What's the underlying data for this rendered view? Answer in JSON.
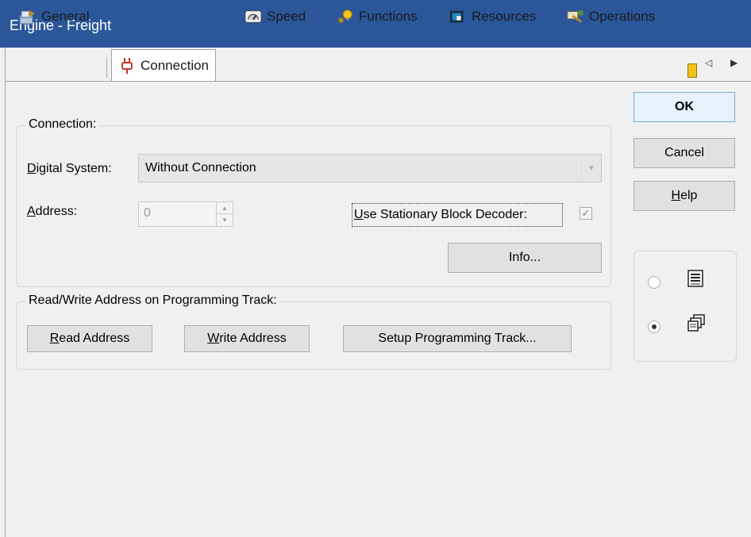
{
  "window": {
    "title": "Engine - Freight"
  },
  "tabs": [
    {
      "label": "General",
      "icon": "general-icon"
    },
    {
      "label": "Connection",
      "icon": "plug-icon"
    },
    {
      "label": "Speed",
      "icon": "speedometer-icon"
    },
    {
      "label": "Functions",
      "icon": "functions-icon"
    },
    {
      "label": "Resources",
      "icon": "resources-icon"
    },
    {
      "label": "Operations",
      "icon": "operations-icon"
    }
  ],
  "connection": {
    "legend": "Connection:",
    "digital_system_label": "Digital System:",
    "digital_system_value": "Without Connection",
    "address_label": "Address:",
    "address_value": "0",
    "stationary_label": "Use Stationary Block Decoder:",
    "stationary_checked": true,
    "info_button": "Info..."
  },
  "programming": {
    "legend": "Read/Write Address on Programming Track:",
    "read_button": "Read Address",
    "write_button": "Write Address",
    "setup_button": "Setup Programming Track..."
  },
  "actions": {
    "ok": "OK",
    "cancel": "Cancel",
    "help": "Help"
  },
  "view_options": [
    {
      "icon": "list-view-icon",
      "selected": false
    },
    {
      "icon": "multi-window-icon",
      "selected": true
    }
  ],
  "colors": {
    "titlebar": "#2b579a",
    "default_button": "#e5f1fb"
  }
}
